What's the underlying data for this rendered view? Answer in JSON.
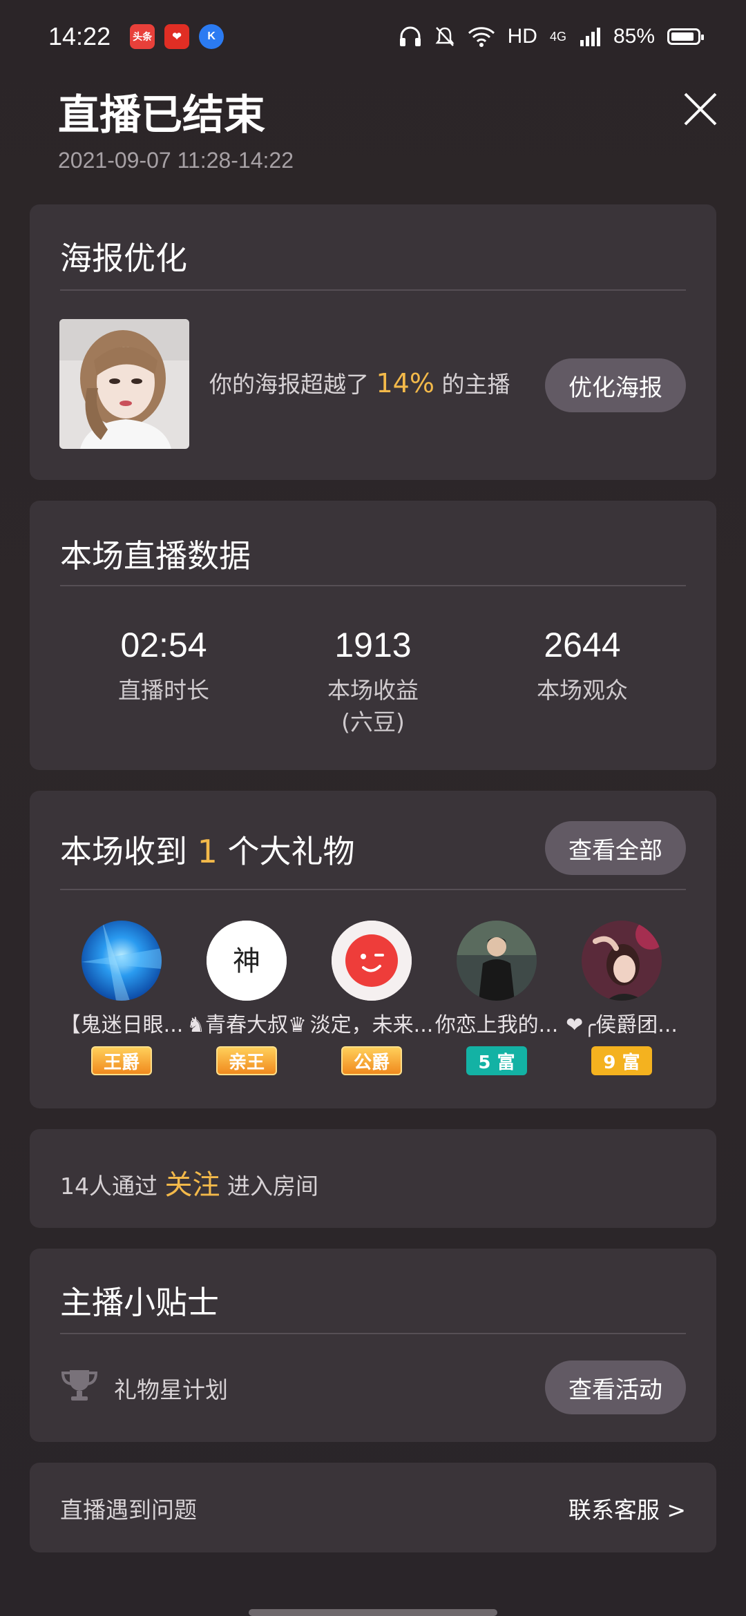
{
  "status_bar": {
    "time": "14:22",
    "apps": [
      {
        "name": "toutiao-app-icon",
        "label": "头条",
        "color": "#e8403a"
      },
      {
        "name": "pinduoduo-app-icon",
        "label": "❤",
        "color": "#e02e24"
      },
      {
        "name": "kugou-app-icon",
        "label": "K",
        "color": "#2b7bf2"
      }
    ],
    "hd": "HD",
    "network": "4G",
    "battery": "85%"
  },
  "header": {
    "title": "直播已结束",
    "time_range": "2021-09-07 11:28-14:22"
  },
  "poster": {
    "title": "海报优化",
    "text_before": "你的海报超越了",
    "percent": "14%",
    "text_after": "的主播",
    "button": "优化海报"
  },
  "stats": {
    "title": "本场直播数据",
    "items": [
      {
        "value": "02:54",
        "label": "直播时长",
        "sub": ""
      },
      {
        "value": "1913",
        "label": "本场收益",
        "sub": "(六豆)"
      },
      {
        "value": "2644",
        "label": "本场观众",
        "sub": ""
      }
    ]
  },
  "gifts": {
    "title_before": "本场收到",
    "count": "1",
    "title_after": "个大礼物",
    "button": "查看全部",
    "gifters": [
      {
        "name": "【鬼迷日眼...",
        "badge": "王爵",
        "badge_type": "noble"
      },
      {
        "name": "♞青春大叔♛",
        "badge": "亲王",
        "badge_type": "noble"
      },
      {
        "name": "淡定，未来...",
        "badge": "公爵",
        "badge_type": "noble"
      },
      {
        "name": "你恋上我的...",
        "badge": "5 富",
        "badge_type": "rich-teal"
      },
      {
        "name": "❤╭侯爵团...",
        "badge": "9 富",
        "badge_type": "rich-gold"
      }
    ]
  },
  "follow": {
    "text_before": "14人通过",
    "highlight": "关注",
    "text_after": "进入房间"
  },
  "tips": {
    "title": "主播小贴士",
    "item_label": "礼物星计划",
    "button": "查看活动"
  },
  "support": {
    "label": "直播遇到问题",
    "link": "联系客服 >"
  }
}
